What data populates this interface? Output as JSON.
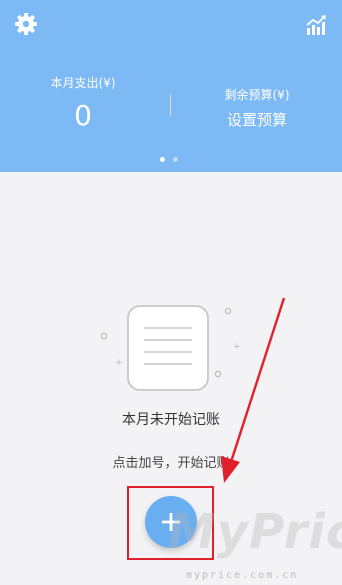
{
  "header": {
    "settings_icon": "gear-icon",
    "trend_icon": "trend-chart-icon",
    "expense_label": "本月支出(¥)",
    "expense_value": "0",
    "budget_label": "剩余预算(¥)",
    "budget_link": "设置预算",
    "carousel": {
      "count": 2,
      "active_index": 0
    },
    "background_color": "#7cb9f5"
  },
  "empty_state": {
    "title": "本月未开始记账",
    "hint": "点击加号，开始记账"
  },
  "add_button": {
    "icon": "plus-icon",
    "color": "#6aaef2"
  },
  "annotation": {
    "highlight_color": "#e0202a"
  },
  "watermark": {
    "brand": "MyPrice",
    "domain": "myprice.com.cn"
  }
}
